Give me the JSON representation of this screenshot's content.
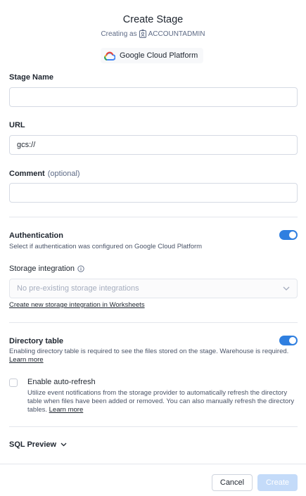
{
  "header": {
    "title": "Create Stage",
    "creating_as_label": "Creating as",
    "role": "ACCOUNTADMIN",
    "platform": "Google Cloud Platform"
  },
  "form": {
    "stage_name": {
      "label": "Stage Name",
      "value": ""
    },
    "url": {
      "label": "URL",
      "value": "gcs://"
    },
    "comment": {
      "label": "Comment",
      "optional": "(optional)",
      "value": ""
    },
    "authentication": {
      "label": "Authentication",
      "description": "Select if authentication was configured on Google Cloud Platform",
      "enabled": true
    },
    "storage_integration": {
      "label": "Storage integration",
      "placeholder": "No pre-existing storage integrations",
      "create_link": "Create new storage integration in Worksheets"
    },
    "directory_table": {
      "label": "Directory table",
      "description": "Enabling directory table is required to see the files stored on the stage. Warehouse is required.",
      "learn_more": "Learn more",
      "enabled": true
    },
    "auto_refresh": {
      "label": "Enable auto-refresh",
      "description": "Utilize event notifications from the storage provider to automatically refresh the directory table when files have been added or removed. You can also manually refresh the directory tables.",
      "learn_more": "Learn more",
      "checked": false
    },
    "sql_preview": "SQL Preview"
  },
  "footer": {
    "cancel_label": "Cancel",
    "create_label": "Create"
  },
  "colors": {
    "accent": "#2f7fe0",
    "create_disabled": "#c4dbf9"
  }
}
